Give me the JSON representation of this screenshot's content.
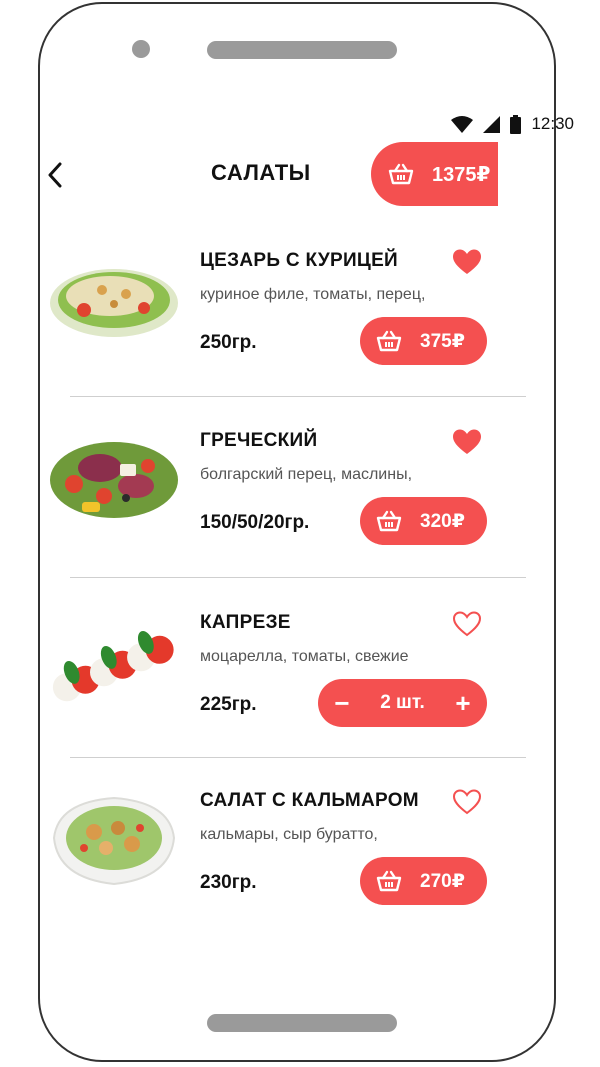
{
  "status_bar": {
    "time": "12:30"
  },
  "header": {
    "title": "САЛАТЫ",
    "cart_total": "1375₽",
    "icons": {
      "back": "chevron-left-icon",
      "cart": "basket-icon"
    }
  },
  "colors": {
    "accent": "#f45050",
    "text": "#111111",
    "muted": "#555555",
    "divider": "#cfcfcf"
  },
  "items": [
    {
      "name": "ЦЕЗАРЬ С КУРИЦЕЙ",
      "desc": "куриное филе, томаты, перец,",
      "weight": "250гр.",
      "price": "375₽",
      "favorite": true,
      "image": "caesar-salad-image"
    },
    {
      "name": "ГРЕЧЕСКИЙ",
      "desc": "болгарский перец, маслины,",
      "weight": "150/50/20гр.",
      "price": "320₽",
      "favorite": true,
      "image": "greek-salad-image"
    },
    {
      "name": "КАПРЕЗЕ",
      "desc": "моцарелла, томаты, свежие",
      "weight": "225гр.",
      "quantity": "2 шт.",
      "minus": "−",
      "plus": "+",
      "favorite": false,
      "image": "caprese-salad-image"
    },
    {
      "name": "САЛАТ С КАЛЬМАРОМ",
      "desc": "кальмары, сыр буратто,",
      "weight": "230гр.",
      "price": "270₽",
      "favorite": false,
      "image": "squid-salad-image"
    }
  ]
}
